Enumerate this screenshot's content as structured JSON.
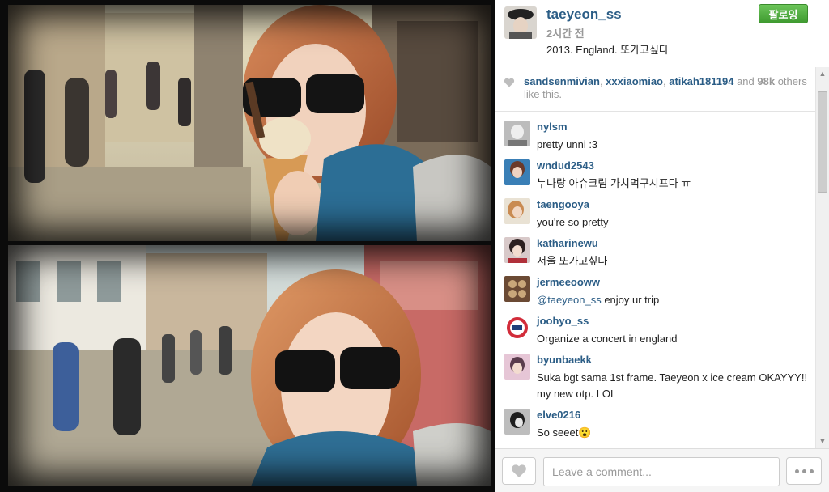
{
  "post": {
    "username": "taeyeon_ss",
    "time_ago": "2시간 전",
    "caption": "2013. England. 또가고싶다",
    "follow_label": "팔로잉"
  },
  "likes": {
    "users": [
      "sandsenmivian",
      "xxxiaomiao",
      "atikah181194"
    ],
    "sep1": ", ",
    "sep2": ", ",
    "and_text": " and ",
    "count": "98k",
    "suffix": " others like this."
  },
  "comments": [
    {
      "user": "nylsm",
      "text": "pretty unni :3"
    },
    {
      "user": "wndud2543",
      "text": "누나랑 아슈크림 가치먹구시프다 ㅠ"
    },
    {
      "user": "taengooya",
      "text": "you're so pretty"
    },
    {
      "user": "katharinewu",
      "text": "서울 또가고싶다"
    },
    {
      "user": "jermeeooww",
      "mention": "@taeyeon_ss",
      "text": " enjoy ur trip"
    },
    {
      "user": "joohyo_ss",
      "text": "Organize a concert in england"
    },
    {
      "user": "byunbaekk",
      "text": "Suka bgt sama 1st frame. Taeyeon x ice cream OKAYYY!! my new otp. LOL"
    },
    {
      "user": "elve0216",
      "text": "So seeet😮"
    }
  ],
  "footer": {
    "comment_placeholder": "Leave a comment..."
  },
  "icons": {
    "like": "heart-icon",
    "more": "more-dots-icon",
    "scroll_up": "scroll-up-arrow-icon",
    "scroll_down": "scroll-down-arrow-icon"
  },
  "colors": {
    "username": "#2b5d86",
    "follow_button": "#4fae3e",
    "muted_text": "#999999"
  }
}
